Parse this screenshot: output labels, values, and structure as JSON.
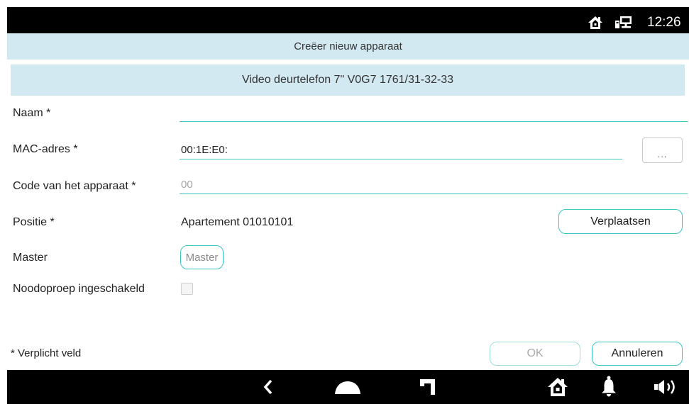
{
  "status_bar": {
    "time": "12:26",
    "icons": [
      "home-icon",
      "network-icon"
    ]
  },
  "header": {
    "title": "Creëer nieuw apparaat"
  },
  "device": {
    "model": "Video deurtelefon 7\" V0G7 1761/31-32-33"
  },
  "form": {
    "name": {
      "label": "Naam *",
      "value": ""
    },
    "mac": {
      "label": "MAC-adres *",
      "value": "00:1E:E0:",
      "button_label": "..."
    },
    "code": {
      "label": "Code van het apparaat *",
      "value": "",
      "placeholder": "00"
    },
    "position": {
      "label": "Positie *",
      "value": "Apartement 01010101",
      "button_label": "Verplaatsen"
    },
    "master": {
      "label": "Master",
      "button_label": "Master"
    },
    "emergency_call": {
      "label": "Noodoproep ingeschakeld",
      "checked": false
    }
  },
  "footer": {
    "required_note": "* Verplicht veld",
    "ok_label": "OK",
    "ok_enabled": false,
    "cancel_label": "Annuleren"
  },
  "nav_bar": {
    "icons": [
      "back-icon",
      "home-dome-icon",
      "recent-apps-icon",
      "house-icon",
      "bell-icon",
      "volume-icon"
    ]
  },
  "colors": {
    "accent": "#3cc7c3",
    "header_background": "#d2e9f1",
    "system_bar": "#000000"
  }
}
